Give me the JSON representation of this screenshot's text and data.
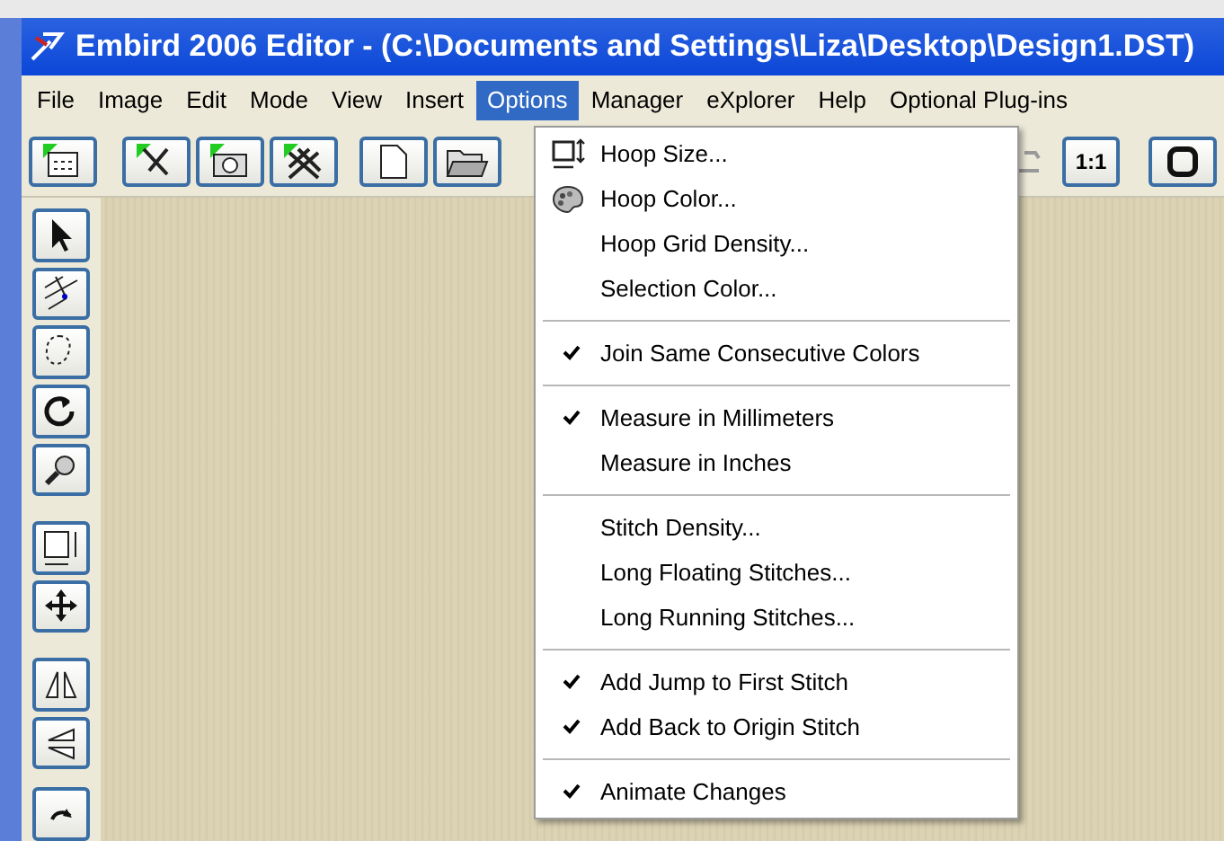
{
  "window": {
    "title": "Embird 2006 Editor - (C:\\Documents and Settings\\Liza\\Desktop\\Design1.DST)"
  },
  "menu_bar": [
    {
      "label": "File",
      "selected": false
    },
    {
      "label": "Image",
      "selected": false
    },
    {
      "label": "Edit",
      "selected": false
    },
    {
      "label": "Mode",
      "selected": false
    },
    {
      "label": "View",
      "selected": false
    },
    {
      "label": "Insert",
      "selected": false
    },
    {
      "label": "Options",
      "selected": true
    },
    {
      "label": "Manager",
      "selected": false
    },
    {
      "label": "eXplorer",
      "selected": false
    },
    {
      "label": "Help",
      "selected": false
    },
    {
      "label": "Optional Plug-ins",
      "selected": false
    }
  ],
  "toolbar": {
    "right_button_label": "1:1"
  },
  "options_menu": [
    {
      "kind": "item",
      "label": "Hoop Size...",
      "checked": false
    },
    {
      "kind": "item",
      "label": "Hoop Color...",
      "checked": false
    },
    {
      "kind": "item",
      "label": "Hoop Grid Density...",
      "checked": false
    },
    {
      "kind": "item",
      "label": "Selection Color...",
      "checked": false
    },
    {
      "kind": "separator"
    },
    {
      "kind": "item",
      "label": "Join Same Consecutive Colors",
      "checked": true
    },
    {
      "kind": "separator"
    },
    {
      "kind": "item",
      "label": "Measure in Millimeters",
      "checked": true
    },
    {
      "kind": "item",
      "label": "Measure in Inches",
      "checked": false
    },
    {
      "kind": "separator"
    },
    {
      "kind": "item",
      "label": "Stitch Density...",
      "checked": false
    },
    {
      "kind": "item",
      "label": "Long Floating Stitches...",
      "checked": false
    },
    {
      "kind": "item",
      "label": "Long Running Stitches...",
      "checked": false
    },
    {
      "kind": "separator"
    },
    {
      "kind": "item",
      "label": "Add Jump to First Stitch",
      "checked": true
    },
    {
      "kind": "item",
      "label": "Add Back to Origin Stitch",
      "checked": true
    },
    {
      "kind": "separator"
    },
    {
      "kind": "item",
      "label": "Animate Changes",
      "checked": true
    }
  ]
}
